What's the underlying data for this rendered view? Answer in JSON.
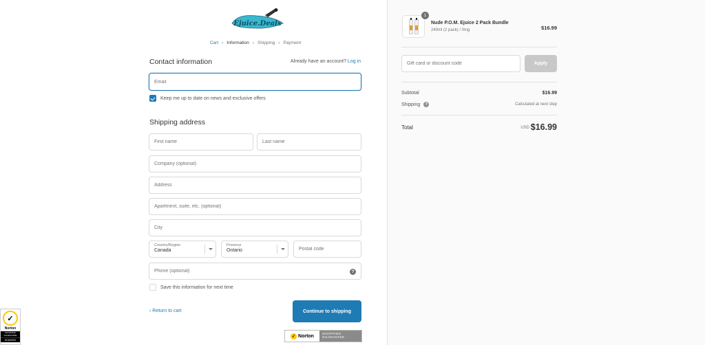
{
  "breadcrumb": [
    "Cart",
    "Information",
    "Shipping",
    "Payment"
  ],
  "contact": {
    "title": "Contact information",
    "account_prompt": "Already have an account?",
    "login_link": "Log in",
    "email_placeholder": "Email",
    "newsletter_label": "Keep me up to date on news and exclusive offers",
    "newsletter_checked": true
  },
  "shipping": {
    "title": "Shipping address",
    "first_name_placeholder": "First name",
    "last_name_placeholder": "Last name",
    "company_placeholder": "Company (optional)",
    "address_placeholder": "Address",
    "apartment_placeholder": "Apartment, suite, etc. (optional)",
    "city_placeholder": "City",
    "country_label": "Country/Region",
    "country_value": "Canada",
    "province_label": "Province",
    "province_value": "Ontario",
    "postal_placeholder": "Postal code",
    "phone_placeholder": "Phone (optional)",
    "save_info_label": "Save this information for next time",
    "save_info_checked": false
  },
  "actions": {
    "return_link": "‹ Return to cart",
    "continue_button": "Continue to shipping"
  },
  "order": {
    "product_name": "Nude P.O.M. Ejuice 2 Pack Bundle",
    "product_variant": "240ml (2 pack) / 0mg",
    "product_price": "$16.99",
    "quantity": "1",
    "discount_placeholder": "Gift card or discount code",
    "apply_button": "Apply",
    "subtotal_label": "Subtotal",
    "subtotal_value": "$16.99",
    "shipping_label": "Shipping",
    "shipping_value": "Calculated at next step",
    "total_label": "Total",
    "total_currency": "USD",
    "total_value": "$16.99"
  },
  "colors": {
    "accent": "#1f7bb4",
    "logo_teal": "#3bb7cf",
    "norton_yellow": "#ffc700"
  }
}
